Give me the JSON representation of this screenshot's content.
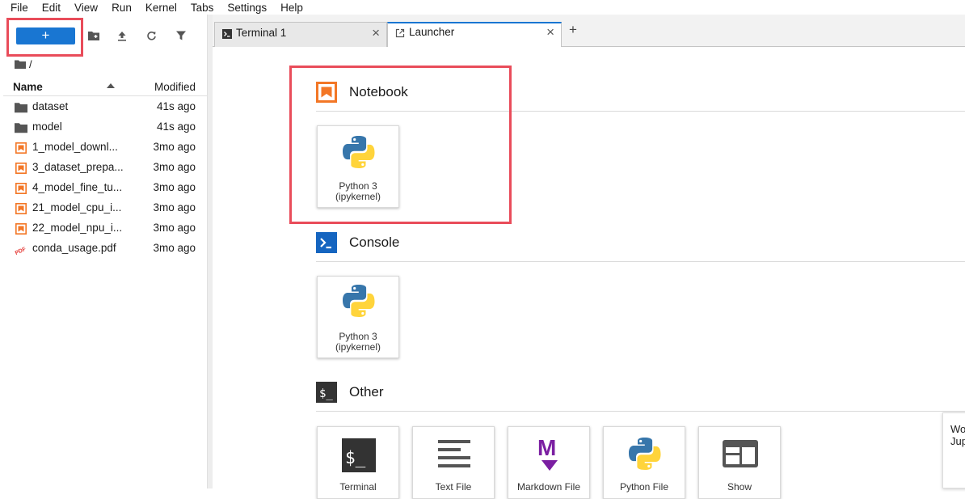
{
  "menu": [
    "File",
    "Edit",
    "View",
    "Run",
    "Kernel",
    "Tabs",
    "Settings",
    "Help"
  ],
  "sidebar": {
    "new_button_label": "+",
    "breadcrumb": "/",
    "header": {
      "name": "Name",
      "modified": "Modified"
    },
    "files": [
      {
        "name": "dataset",
        "modified": "41s ago",
        "type": "folder"
      },
      {
        "name": "model",
        "modified": "41s ago",
        "type": "folder"
      },
      {
        "name": "1_model_downl...",
        "modified": "3mo ago",
        "type": "notebook"
      },
      {
        "name": "3_dataset_prepa...",
        "modified": "3mo ago",
        "type": "notebook"
      },
      {
        "name": "4_model_fine_tu...",
        "modified": "3mo ago",
        "type": "notebook"
      },
      {
        "name": "21_model_cpu_i...",
        "modified": "3mo ago",
        "type": "notebook"
      },
      {
        "name": "22_model_npu_i...",
        "modified": "3mo ago",
        "type": "notebook"
      },
      {
        "name": "conda_usage.pdf",
        "modified": "3mo ago",
        "type": "pdf"
      }
    ]
  },
  "tabs": [
    {
      "label": "Terminal 1",
      "close": "×"
    },
    {
      "label": "Launcher",
      "close": "×"
    }
  ],
  "add_tab": "+",
  "launcher": {
    "notebook": {
      "title": "Notebook",
      "card_line1": "Python 3",
      "card_line2": "(ipykernel)"
    },
    "console": {
      "title": "Console",
      "card_line1": "Python 3",
      "card_line2": "(ipykernel)"
    },
    "other": {
      "title": "Other",
      "cards": [
        "Terminal",
        "Text File",
        "Markdown File",
        "Python File",
        "Show"
      ]
    }
  },
  "toast": {
    "line1": "Wo",
    "line2": "Jup"
  },
  "colors": {
    "accent": "#1976d2",
    "highlight": "#e94c5a",
    "notebook_orange": "#f37726",
    "markdown_purple": "#7b1fa2"
  }
}
